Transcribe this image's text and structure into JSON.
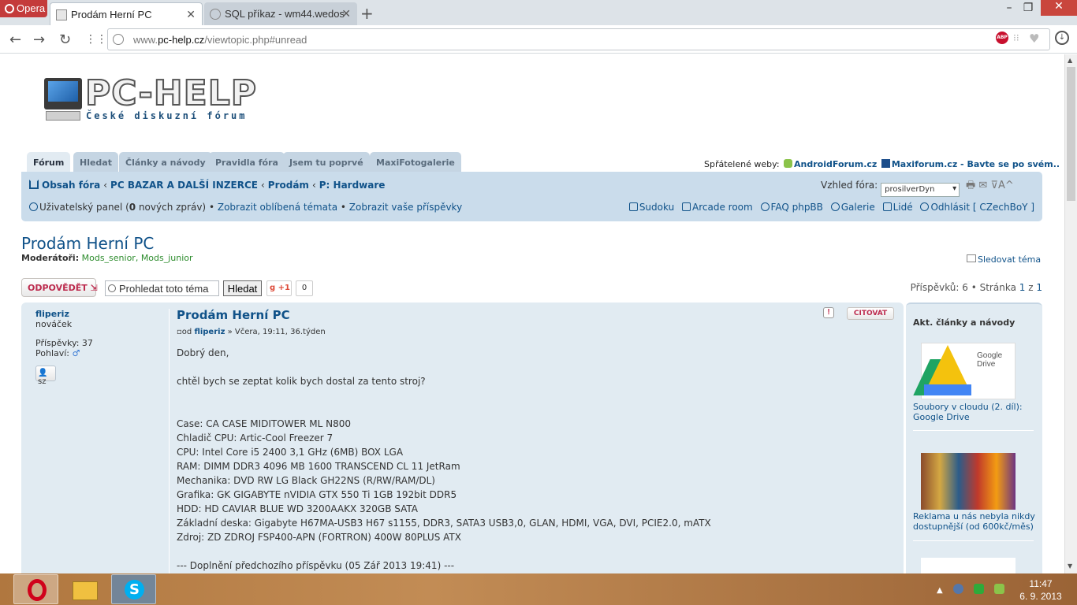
{
  "browser": {
    "menu_label": "Opera",
    "tabs": [
      {
        "title": "Prodám Herní PC",
        "active": true
      },
      {
        "title": "SQL příkaz - wm44.wedos",
        "active": false
      }
    ],
    "url_prefix": "www.",
    "url_domain": "pc-help.cz",
    "url_path": "/viewtopic.php#unread",
    "adblock_label": "ABP"
  },
  "logo": {
    "title": "PC-HELP",
    "subtitle": "České diskuzní fórum"
  },
  "nav_tabs": [
    "Fórum",
    "Hledat",
    "Články a návody",
    "Pravidla fóra",
    "Jsem tu poprvé",
    "MaxiFotogalerie"
  ],
  "friends": {
    "label": "Spřátelené weby:",
    "site1": "AndroidForum.cz",
    "site2": "Maxiforum.cz - Bavte se po svém.."
  },
  "breadcrumbs": [
    "Obsah fóra",
    "PC BAZAR A DALŠÍ INZERCE",
    "Prodám",
    "P: Hardware"
  ],
  "style_switch": {
    "label": "Vzhled fóra:",
    "value": "prosilverDyn"
  },
  "tools_text": "🖶  ✉  ⊽A^",
  "user_links": {
    "panel": "Uživatelský panel (",
    "new_count": "0",
    "panel_end": " nových zpráv)",
    "fav": "Zobrazit oblíbená témata",
    "posts": "Zobrazit vaše příspěvky"
  },
  "right_links": [
    "Sudoku",
    "Arcade room",
    "FAQ phpBB",
    "Galerie",
    "Lidé",
    "Odhlásit [ CZechBoY ]"
  ],
  "topic": {
    "title": "Prodám Herní PC",
    "mods_label": "Moderátoři:",
    "mods": "Mods_senior, Mods_junior",
    "watch": "Sledovat téma",
    "reply": "ODPOVĚDĚT",
    "search_placeholder": "Prohledat toto téma",
    "search_btn": "Hledat",
    "gplus": "+1",
    "gcount": "0",
    "pagination": "Příspěvků: 6 • Stránka",
    "page_current": "1",
    "page_of": "z",
    "page_total": "1"
  },
  "post": {
    "author": "fliperiz",
    "rank": "nováček",
    "posts_label": "Příspěvky: 37",
    "gender_label": "Pohlaví:",
    "pm_label": "sz",
    "title": "Prodám Herní PC",
    "meta_pre": "od",
    "meta_author": "fliperiz",
    "meta_post": "» Včera, 19:11, 36.týden",
    "quote": "CITOVAT",
    "body": "Dobrý den,\n\nchtěl bych se zeptat kolik bych dostal za tento stroj?\n\n\nCase: CA CASE MIDITOWER ML N800\nChladič CPU: Artic-Cool Freezer 7\nCPU: Intel Core i5 2400 3,1 GHz (6MB) BOX LGA\nRAM: DIMM DDR3 4096 MB 1600 TRANSCEND CL 11 JetRam\nMechanika: DVD RW LG Black GH22NS (R/RW/RAM/DL)\nGrafika: GK GIGABYTE nVIDIA GTX 550 Ti 1GB 192bit DDR5\nHDD: HD CAVIAR BLUE WD 3200AAKX 320GB SATA\nZákladní deska: Gigabyte H67MA-USB3 H67 s1155, DDR3, SATA3 USB3,0, GLAN, HDMI, VGA, DVI, PCIE2.0, mATX\nZdroj: ZD ZDROJ FSP400-APN (FORTRON) 400W 80PLUS ATX\n\n--- Doplnění předchozího příspěvku (05 Zář 2013 19:41) ---"
  },
  "sidebar": {
    "heading": "Akt. články a návody",
    "thumb1_text": "Google Drive",
    "article1": "Soubory v cloudu (2. díl): Google Drive",
    "article2": "Reklama u nás nebyla nikdy dostupnější (od 600kč/měs)"
  },
  "taskbar": {
    "time": "11:47",
    "date": "6. 9. 2013"
  }
}
